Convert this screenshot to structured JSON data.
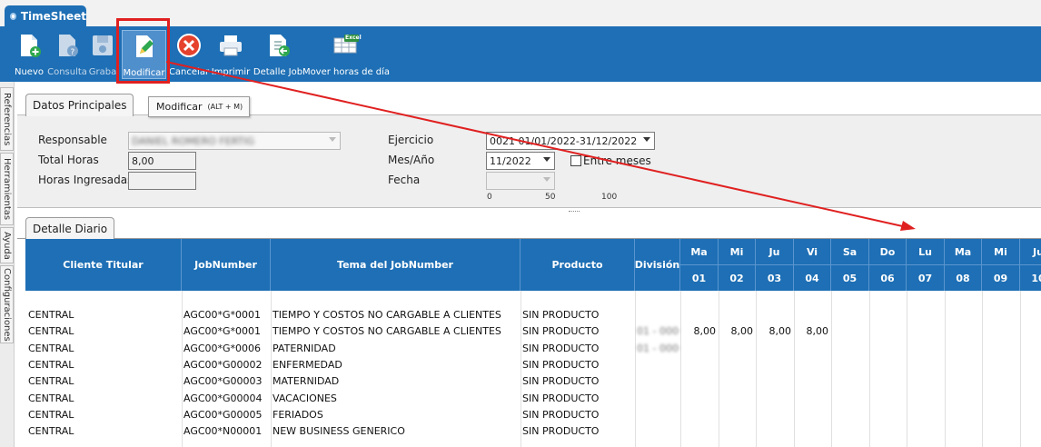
{
  "app": {
    "title": "TimeSheet"
  },
  "toolbar": {
    "buttons": [
      {
        "label": "Nuevo",
        "icon": "new-document-icon"
      },
      {
        "label": "Consulta",
        "icon": "query-document-icon"
      },
      {
        "label": "Graba",
        "icon": "save-disk-icon"
      },
      {
        "label": "Modificar",
        "icon": "edit-pencil-icon"
      },
      {
        "label": "Cancelar",
        "icon": "cancel-x-icon"
      },
      {
        "label": "Imprimir",
        "icon": "printer-icon"
      },
      {
        "label": "Detalle Job",
        "icon": "document-arrow-icon"
      },
      {
        "label": "Mover horas de día",
        "icon": "excel-icon"
      }
    ],
    "excel_badge": "Excel"
  },
  "tooltip": {
    "text": "Modificar",
    "shortcut": "(ALT + M)"
  },
  "side_tabs": [
    "Referencias",
    "Herramientas",
    "Ayuda",
    "Configuraciones"
  ],
  "main": {
    "tab": "Datos Principales",
    "responsable_label": "Responsable",
    "responsable_value": "DANIEL ROMERO FERTIG",
    "total_horas_label": "Total Horas",
    "total_horas_value": "8,00",
    "horas_ingresadas_label": "Horas Ingresadas",
    "horas_ingresadas_value": "",
    "ejercicio_label": "Ejercicio",
    "ejercicio_value": "0021 01/01/2022-31/12/2022",
    "mes_label": "Mes/Año",
    "mes_value": "11/2022",
    "entre_meses_label": "Entre meses",
    "fecha_label": "Fecha",
    "fecha_value": "",
    "scale_ticks": [
      "0",
      "50",
      "100"
    ]
  },
  "detalle": {
    "tab": "Detalle Diario",
    "columns": [
      "Cliente Titular",
      "JobNumber",
      "Tema del JobNumber",
      "Producto",
      "División"
    ],
    "days": [
      {
        "dow": "Ma",
        "num": "01"
      },
      {
        "dow": "Mi",
        "num": "02"
      },
      {
        "dow": "Ju",
        "num": "03"
      },
      {
        "dow": "Vi",
        "num": "04"
      },
      {
        "dow": "Sa",
        "num": "05"
      },
      {
        "dow": "Do",
        "num": "06"
      },
      {
        "dow": "Lu",
        "num": "07"
      },
      {
        "dow": "Ma",
        "num": "08"
      },
      {
        "dow": "Mi",
        "num": "09"
      },
      {
        "dow": "Ju",
        "num": "10"
      }
    ],
    "rows": [
      {
        "cliente": "CENTRAL",
        "job": "AGC00*G*0001",
        "tema": "TIEMPO Y COSTOS NO CARGABLE A CLIENTES",
        "producto": "SIN PRODUCTO",
        "division": "",
        "hours": [
          "",
          "",
          "",
          ""
        ]
      },
      {
        "cliente": "CENTRAL",
        "job": "AGC00*G*0001",
        "tema": "TIEMPO Y COSTOS NO CARGABLE A CLIENTES",
        "producto": "SIN PRODUCTO",
        "division": "01 - 0000",
        "hours": [
          "8,00",
          "8,00",
          "8,00",
          "8,00"
        ]
      },
      {
        "cliente": "CENTRAL",
        "job": "AGC00*G*0006",
        "tema": "PATERNIDAD",
        "producto": "SIN PRODUCTO",
        "division": "01 - 0000",
        "hours": [
          "",
          "",
          "",
          ""
        ]
      },
      {
        "cliente": "CENTRAL",
        "job": "AGC00*G00002",
        "tema": "ENFERMEDAD",
        "producto": "SIN PRODUCTO",
        "division": "",
        "hours": [
          "",
          "",
          "",
          ""
        ]
      },
      {
        "cliente": "CENTRAL",
        "job": "AGC00*G00003",
        "tema": "MATERNIDAD",
        "producto": "SIN PRODUCTO",
        "division": "",
        "hours": [
          "",
          "",
          "",
          ""
        ]
      },
      {
        "cliente": "CENTRAL",
        "job": "AGC00*G00004",
        "tema": "VACACIONES",
        "producto": "SIN PRODUCTO",
        "division": "",
        "hours": [
          "",
          "",
          "",
          ""
        ]
      },
      {
        "cliente": "CENTRAL",
        "job": "AGC00*G00005",
        "tema": "FERIADOS",
        "producto": "SIN PRODUCTO",
        "division": "",
        "hours": [
          "",
          "",
          "",
          ""
        ]
      },
      {
        "cliente": "CENTRAL",
        "job": "AGC00*N00001",
        "tema": "NEW BUSINESS GENERICO",
        "producto": "SIN PRODUCTO",
        "division": "",
        "hours": [
          "",
          "",
          "",
          ""
        ]
      }
    ]
  },
  "colors": {
    "toolbar_blue": "#1e6fb5",
    "header_blue": "#1e6fb5",
    "highlight_red": "#e02020",
    "active_button": "#4f8fcc"
  }
}
